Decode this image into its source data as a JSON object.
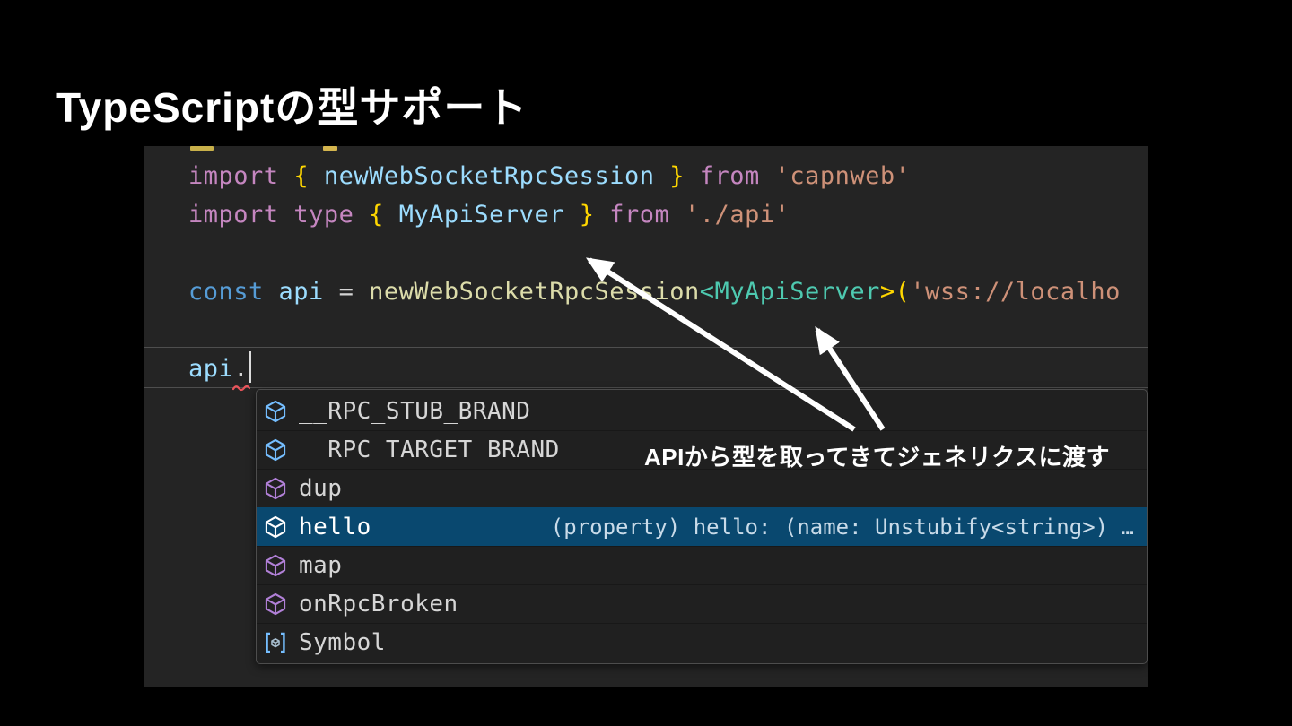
{
  "slide": {
    "title": "TypeScriptの型サポート",
    "annotation": "APIから型を取ってきてジェネリクスに渡す"
  },
  "editor": {
    "token_colors": {
      "kw": "#C586C0",
      "kwConst": "#569CD6",
      "variable": "#9CDCFE",
      "type": "#4EC9B0",
      "func": "#DCDCAA",
      "string": "#CE9178",
      "brace": "#FFD700",
      "fg": "#D4D4D4"
    },
    "code_lines": [
      [
        {
          "t": "import",
          "c": "kw"
        },
        {
          "t": " "
        },
        {
          "t": "{",
          "c": "brace"
        },
        {
          "t": " "
        },
        {
          "t": "newWebSocketRpcSession",
          "c": "variable"
        },
        {
          "t": " "
        },
        {
          "t": "}",
          "c": "brace"
        },
        {
          "t": " "
        },
        {
          "t": "from",
          "c": "kw"
        },
        {
          "t": " "
        },
        {
          "t": "'capnweb'",
          "c": "string"
        }
      ],
      [
        {
          "t": "import",
          "c": "kw"
        },
        {
          "t": " "
        },
        {
          "t": "type",
          "c": "kw"
        },
        {
          "t": " "
        },
        {
          "t": "{",
          "c": "brace"
        },
        {
          "t": " "
        },
        {
          "t": "MyApiServer",
          "c": "variable"
        },
        {
          "t": " "
        },
        {
          "t": "}",
          "c": "brace"
        },
        {
          "t": " "
        },
        {
          "t": "from",
          "c": "kw"
        },
        {
          "t": " "
        },
        {
          "t": "'./api'",
          "c": "string"
        }
      ],
      [],
      [
        {
          "t": "const",
          "c": "kwConst"
        },
        {
          "t": " "
        },
        {
          "t": "api",
          "c": "variable"
        },
        {
          "t": " "
        },
        {
          "t": "=",
          "c": "fg"
        },
        {
          "t": " "
        },
        {
          "t": "newWebSocketRpcSession",
          "c": "func"
        },
        {
          "t": "<",
          "c": "type"
        },
        {
          "t": "MyApiServer",
          "c": "type"
        },
        {
          "t": ">",
          "c": "brace"
        },
        {
          "t": "(",
          "c": "brace"
        },
        {
          "t": "'wss://localho",
          "c": "string"
        }
      ],
      [],
      [
        {
          "t": "api",
          "c": "variable"
        },
        {
          "t": ".",
          "c": "fg"
        }
      ]
    ],
    "suggest": {
      "selected_background": "#09486F",
      "icon_colors": {
        "field": "#75BEFF",
        "method": "#B180D7",
        "selected": "#FFFFFF",
        "symbol": "#75BEFF"
      },
      "items": [
        {
          "label": "__RPC_STUB_BRAND",
          "kind": "field",
          "selected": false,
          "detail": ""
        },
        {
          "label": "__RPC_TARGET_BRAND",
          "kind": "field",
          "selected": false,
          "detail": ""
        },
        {
          "label": "dup",
          "kind": "method",
          "selected": false,
          "detail": ""
        },
        {
          "label": "hello",
          "kind": "property",
          "selected": true,
          "detail": "(property) hello: (name: Unstubify<string>) …"
        },
        {
          "label": "map",
          "kind": "method",
          "selected": false,
          "detail": ""
        },
        {
          "label": "onRpcBroken",
          "kind": "method",
          "selected": false,
          "detail": ""
        },
        {
          "label": "Symbol",
          "kind": "symbol",
          "selected": false,
          "detail": ""
        }
      ]
    },
    "error_squiggle_color": "#E8545A",
    "arrow_color": "#FFFFFF"
  }
}
